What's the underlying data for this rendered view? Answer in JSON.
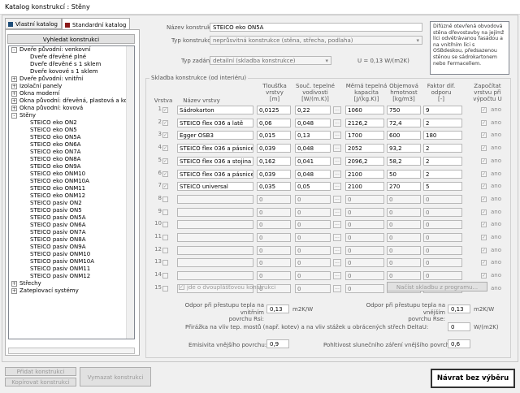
{
  "window": {
    "title": "Katalog konstrukcí : Stěny"
  },
  "tabs": [
    {
      "label": "Vlastní katalog",
      "color": "#1f4e79"
    },
    {
      "label": "Standardní katalog",
      "color": "#8b1a1a"
    }
  ],
  "search_button": "Vyhledat konstrukci",
  "tree": [
    {
      "label": "Dveře původní: venkovní",
      "level": 0,
      "toggle": "-"
    },
    {
      "label": "Dveře dřevěné plné",
      "level": 1
    },
    {
      "label": "Dveře dřevěné s 1 sklem",
      "level": 1
    },
    {
      "label": "Dveře kovové s 1 sklem",
      "level": 1
    },
    {
      "label": "Dveře původní: vnitřní",
      "level": 0,
      "toggle": "+"
    },
    {
      "label": "Izolační panely",
      "level": 0,
      "toggle": "+"
    },
    {
      "label": "Okna moderní",
      "level": 0,
      "toggle": "+"
    },
    {
      "label": "Okna původní: dřevěná, plastová a kombinovaná",
      "level": 0,
      "toggle": "+"
    },
    {
      "label": "Okna původní: kovová",
      "level": 0,
      "toggle": "+"
    },
    {
      "label": "Stěny",
      "level": 0,
      "toggle": "-"
    },
    {
      "label": "STEICO eko ON2",
      "level": 1
    },
    {
      "label": "STEICO eko ON5",
      "level": 1
    },
    {
      "label": "STEICO eko ON5A",
      "level": 1
    },
    {
      "label": "STEICO eko ON6A",
      "level": 1
    },
    {
      "label": "STEICO eko ON7A",
      "level": 1
    },
    {
      "label": "STEICO eko ON8A",
      "level": 1
    },
    {
      "label": "STEICO eko ON9A",
      "level": 1
    },
    {
      "label": "STEICO eko ONM10",
      "level": 1
    },
    {
      "label": "STEICO eko ONM10A",
      "level": 1
    },
    {
      "label": "STEICO eko ONM11",
      "level": 1
    },
    {
      "label": "STEICO eko ONM12",
      "level": 1
    },
    {
      "label": "STEICO pasiv ON2",
      "level": 1
    },
    {
      "label": "STEICO pasiv ON5",
      "level": 1
    },
    {
      "label": "STEICO pasiv ON5A",
      "level": 1
    },
    {
      "label": "STEICO pasiv ON6A",
      "level": 1
    },
    {
      "label": "STEICO pasiv ON7A",
      "level": 1
    },
    {
      "label": "STEICO pasiv ON8A",
      "level": 1
    },
    {
      "label": "STEICO pasiv ON9A",
      "level": 1
    },
    {
      "label": "STEICO pasiv ONM10",
      "level": 1
    },
    {
      "label": "STEICO pasiv ONM10A",
      "level": 1
    },
    {
      "label": "STEICO pasiv ONM11",
      "level": 1
    },
    {
      "label": "STEICO pasiv ONM12",
      "level": 1
    },
    {
      "label": "Střechy",
      "level": 0,
      "toggle": "+"
    },
    {
      "label": "Zateplovací systémy",
      "level": 0,
      "toggle": "+"
    }
  ],
  "form": {
    "name_label": "Název konstrukce:",
    "name_value": "STEICO eko ON5A",
    "type_label": "Typ konstrukce:",
    "type_value": "neprůsvitná konstrukce (stěna, střecha, podlaha)",
    "input_label": "Typ zadání:",
    "input_value": "detailní (skladba konstrukce)",
    "u_value": "U = 0,13 W/(m2K)"
  },
  "description": "Difúzně otevřená obvodová stěna dřevostavby na jejímž líci odvětrávanou fasádou a na vnitřním líci s OSBdeskou, předsazenou stěnou se sádrokartonem nebo Fermacellem.",
  "layers": {
    "title": "Skladba konstrukce (od interiéru)",
    "headers": {
      "layer": "Vrstva",
      "name": "Název vrstvy",
      "thickness": "Tloušťka vrstvy\n[m]",
      "lambda": "Souč. tepelné vodivosti\n[W/(m.K)]",
      "c": "Měrná tepelná kapacita\n[J/(kg.K)]",
      "rho": "Objemová hmotnost\n[kg/m3]",
      "mu": "Faktor dif. odporu\n[-]",
      "count": "Započítat vrstvu při výpočtu U"
    },
    "rows": [
      {
        "n": "1",
        "name": "Sádrokarton",
        "d": "0,0125",
        "l": "0,22",
        "c": "1060",
        "r": "750",
        "mu": "9",
        "ano": "ano"
      },
      {
        "n": "2",
        "name": "STEICO flex 036 a  latě",
        "d": "0,06",
        "l": "0,048",
        "c": "2126,2",
        "r": "72,4",
        "mu": "2",
        "ano": "ano"
      },
      {
        "n": "3",
        "name": "Egger OSB3",
        "d": "0,015",
        "l": "0,13",
        "c": "1700",
        "r": "600",
        "mu": "180",
        "ano": "ano"
      },
      {
        "n": "4",
        "name": "STEICO flex 036 a pásnice",
        "d": "0,039",
        "l": "0,048",
        "c": "2052",
        "r": "93,2",
        "mu": "2",
        "ano": "ano"
      },
      {
        "n": "5",
        "name": "STEICO flex 036 a stojina",
        "d": "0,162",
        "l": "0,041",
        "c": "2096,2",
        "r": "58,2",
        "mu": "2",
        "ano": "ano"
      },
      {
        "n": "6",
        "name": "STEICO flex 036 a pásnice",
        "d": "0,039",
        "l": "0,048",
        "c": "2100",
        "r": "50",
        "mu": "2",
        "ano": "ano"
      },
      {
        "n": "7",
        "name": "STEICO universal",
        "d": "0,035",
        "l": "0,05",
        "c": "2100",
        "r": "270",
        "mu": "5",
        "ano": "ano"
      },
      {
        "n": "8",
        "name": "",
        "d": "0",
        "l": "0",
        "c": "0",
        "r": "0",
        "mu": "0",
        "ano": "ano"
      },
      {
        "n": "9",
        "name": "",
        "d": "0",
        "l": "0",
        "c": "0",
        "r": "0",
        "mu": "0",
        "ano": "ano"
      },
      {
        "n": "10",
        "name": "",
        "d": "0",
        "l": "0",
        "c": "0",
        "r": "0",
        "mu": "0",
        "ano": "ano"
      },
      {
        "n": "11",
        "name": "",
        "d": "0",
        "l": "0",
        "c": "0",
        "r": "0",
        "mu": "0",
        "ano": "ano"
      },
      {
        "n": "12",
        "name": "",
        "d": "0",
        "l": "0",
        "c": "0",
        "r": "0",
        "mu": "0",
        "ano": "ano"
      },
      {
        "n": "13",
        "name": "",
        "d": "0",
        "l": "0",
        "c": "0",
        "r": "0",
        "mu": "0",
        "ano": "ano"
      },
      {
        "n": "14",
        "name": "",
        "d": "0",
        "l": "0",
        "c": "0",
        "r": "0",
        "mu": "0",
        "ano": "ano"
      },
      {
        "n": "15",
        "name": "",
        "d": "0",
        "l": "0",
        "c": "0",
        "r": "0",
        "mu": "0",
        "ano": "ano"
      }
    ],
    "dots": "...",
    "double_label": "jde o dvouplášťovou konstrukci",
    "load_button": "Načíst skladbu z programu..."
  },
  "params": {
    "rsi_label": "Odpor při přestupu tepla na vnitřním\npovrchu Rsi:",
    "rsi_value": "0,13",
    "rsi_unit": "m2K/W",
    "rse_label": "Odpor při přestupu tepla na vnějším\npovrchu Rse:",
    "rse_value": "0,13",
    "rse_unit": "m2K/W",
    "du_label": "Přirážka na vliv tep. mostů (např. kotev) a na vliv stážek u obrácených střech DeltaU:",
    "du_value": "0",
    "du_unit": "W/(m2K)",
    "em_label": "Emisivita vnějšího povrchu:",
    "em_value": "0,9",
    "abs_label": "Pohltivost slunečního záření vnějšího povrchu:",
    "abs_value": "0,6"
  },
  "bottom": {
    "add": "Přidat konstrukci",
    "copy": "Kopírovat konstrukci",
    "delete": "Vymazat konstrukci",
    "return": "Návrat bez výběru"
  }
}
